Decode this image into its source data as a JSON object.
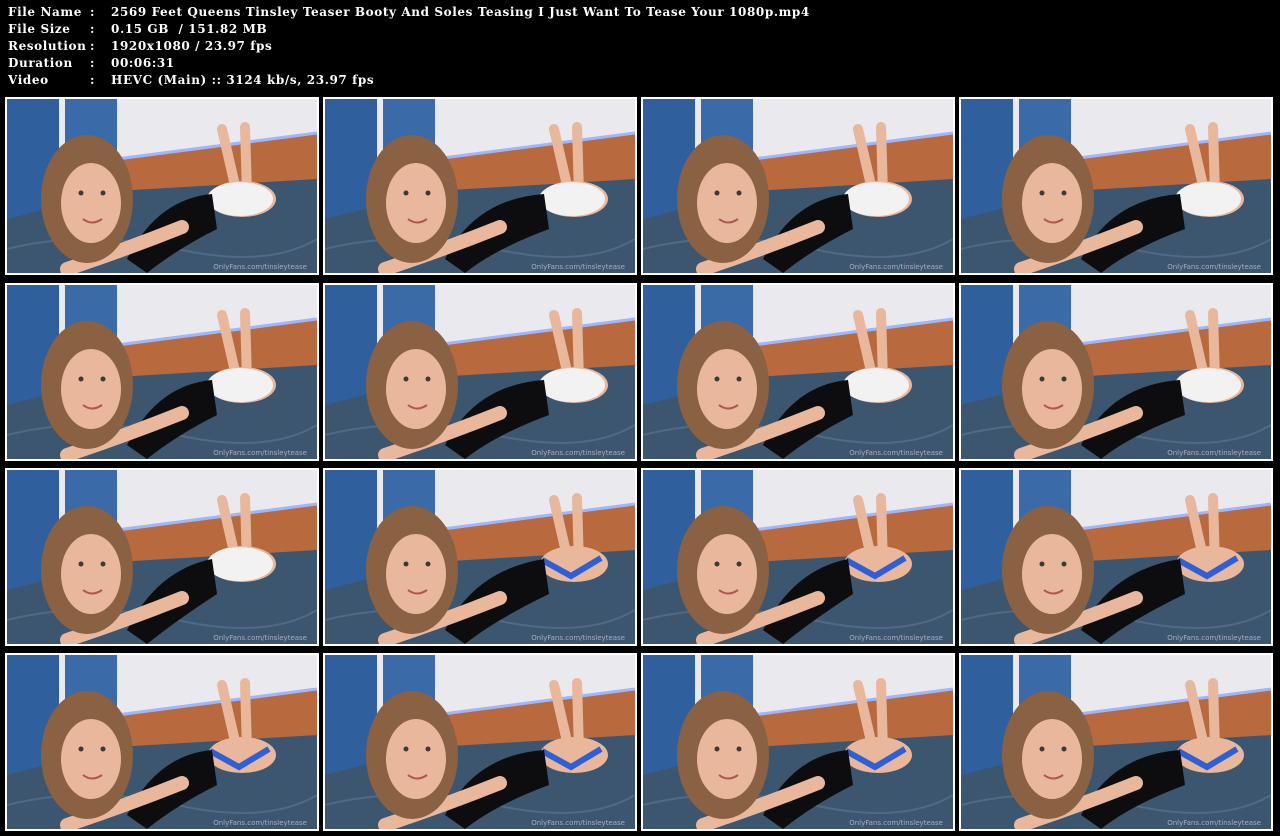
{
  "file_info": {
    "name_label": "File Name",
    "name_value": "2569 Feet Queens Tinsley Teaser Booty And Soles Teasing I Just Want To Tease Your 1080p.mp4",
    "size_label": "File Size",
    "size_value": "0.15 GB  / 151.82 MB",
    "resolution_label": "Resolution",
    "resolution_value": "1920x1080 / 23.97 fps",
    "duration_label": "Duration",
    "duration_value": "00:06:31",
    "video_label": "Video",
    "video_value": "HEVC (Main) :: 3124 kb/s, 23.97 fps",
    "separator": ":"
  },
  "thumbnails": {
    "watermark": "OnlyFans.com/tinsleytease",
    "count": 16,
    "columns": 4,
    "rows": 4,
    "colors": {
      "wall": "#e9e9ee",
      "curtain": "#2f5f9c",
      "headboard": "#b86a3e",
      "led": "#9fb6ff",
      "bed": "#3d5670",
      "shirt": "#0d0d0f",
      "shorts": "#f2f2f2",
      "bikini": "#2e5fd6",
      "skin": "#e9b79c",
      "hair": "#8a6142"
    },
    "frames": [
      {
        "bottoms": "shorts",
        "pose": "A"
      },
      {
        "bottoms": "shorts",
        "pose": "B"
      },
      {
        "bottoms": "shorts",
        "pose": "A"
      },
      {
        "bottoms": "shorts",
        "pose": "B"
      },
      {
        "bottoms": "shorts",
        "pose": "A"
      },
      {
        "bottoms": "shorts",
        "pose": "B"
      },
      {
        "bottoms": "shorts",
        "pose": "A"
      },
      {
        "bottoms": "shorts",
        "pose": "B"
      },
      {
        "bottoms": "shorts",
        "pose": "C"
      },
      {
        "bottoms": "bikini",
        "pose": "D"
      },
      {
        "bottoms": "bikini",
        "pose": "C"
      },
      {
        "bottoms": "bikini",
        "pose": "D"
      },
      {
        "bottoms": "bikini",
        "pose": "A"
      },
      {
        "bottoms": "bikini",
        "pose": "B"
      },
      {
        "bottoms": "bikini",
        "pose": "A"
      },
      {
        "bottoms": "bikini",
        "pose": "B"
      }
    ]
  }
}
